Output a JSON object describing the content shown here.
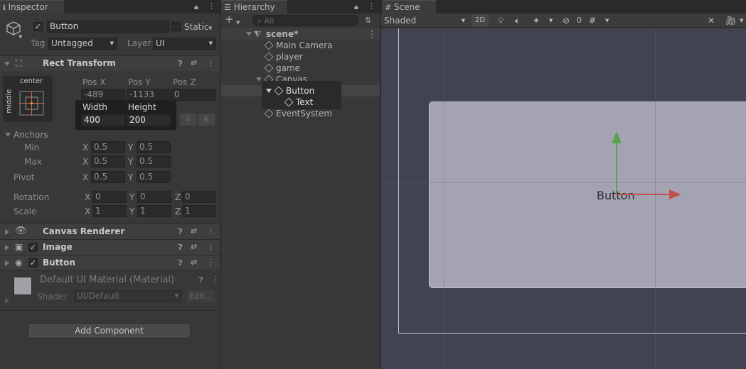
{
  "inspector": {
    "tab_label": "Inspector",
    "object": {
      "name": "Button",
      "static_label": "Static",
      "tag_label": "Tag",
      "tag_value": "Untagged",
      "layer_label": "Layer",
      "layer_value": "UI"
    },
    "rect_transform": {
      "title": "Rect Transform",
      "anchor_preset_top": "center",
      "anchor_preset_side": "middle",
      "pos_x_label": "Pos X",
      "pos_y_label": "Pos Y",
      "pos_z_label": "Pos Z",
      "pos_x": "-489",
      "pos_y": "-1133",
      "pos_z": "0",
      "width_label": "Width",
      "height_label": "Height",
      "width": "400",
      "height": "200",
      "r_button": "R",
      "anchors_label": "Anchors",
      "min_label": "Min",
      "max_label": "Max",
      "pivot_label": "Pivot",
      "rotation_label": "Rotation",
      "scale_label": "Scale",
      "x": "X",
      "y": "Y",
      "z": "Z",
      "min_x": "0.5",
      "min_y": "0.5",
      "max_x": "0.5",
      "max_y": "0.5",
      "pivot_x": "0.5",
      "pivot_y": "0.5",
      "rot_x": "0",
      "rot_y": "0",
      "rot_z": "0",
      "scale_x": "1",
      "scale_y": "1",
      "scale_z": "1"
    },
    "components": [
      {
        "title": "Canvas Renderer"
      },
      {
        "title": "Image"
      },
      {
        "title": "Button"
      }
    ],
    "material": {
      "name": "Default UI Material (Material)",
      "shader_label": "Shader",
      "shader_value": "UI/Default",
      "edit_label": "Edit..."
    },
    "add_component": "Add Component"
  },
  "hierarchy": {
    "tab_label": "Hierarchy",
    "search_placeholder": "All",
    "scene_name": "scene*",
    "items": [
      {
        "label": "Main Camera"
      },
      {
        "label": "player"
      },
      {
        "label": "game"
      },
      {
        "label": "Canvas"
      },
      {
        "label": "Button"
      },
      {
        "label": "Text"
      },
      {
        "label": "EventSystem"
      }
    ]
  },
  "scene": {
    "tab_label": "Scene",
    "shading_mode": "Shaded",
    "mode_2d": "2D",
    "hidden_count": "0",
    "button_text": "Button"
  },
  "colors": {
    "accent_selection": "#4d4d4d",
    "gizmo_x": "#c05050",
    "gizmo_y": "#5aa050",
    "button_fill": "#a3a3b2"
  }
}
